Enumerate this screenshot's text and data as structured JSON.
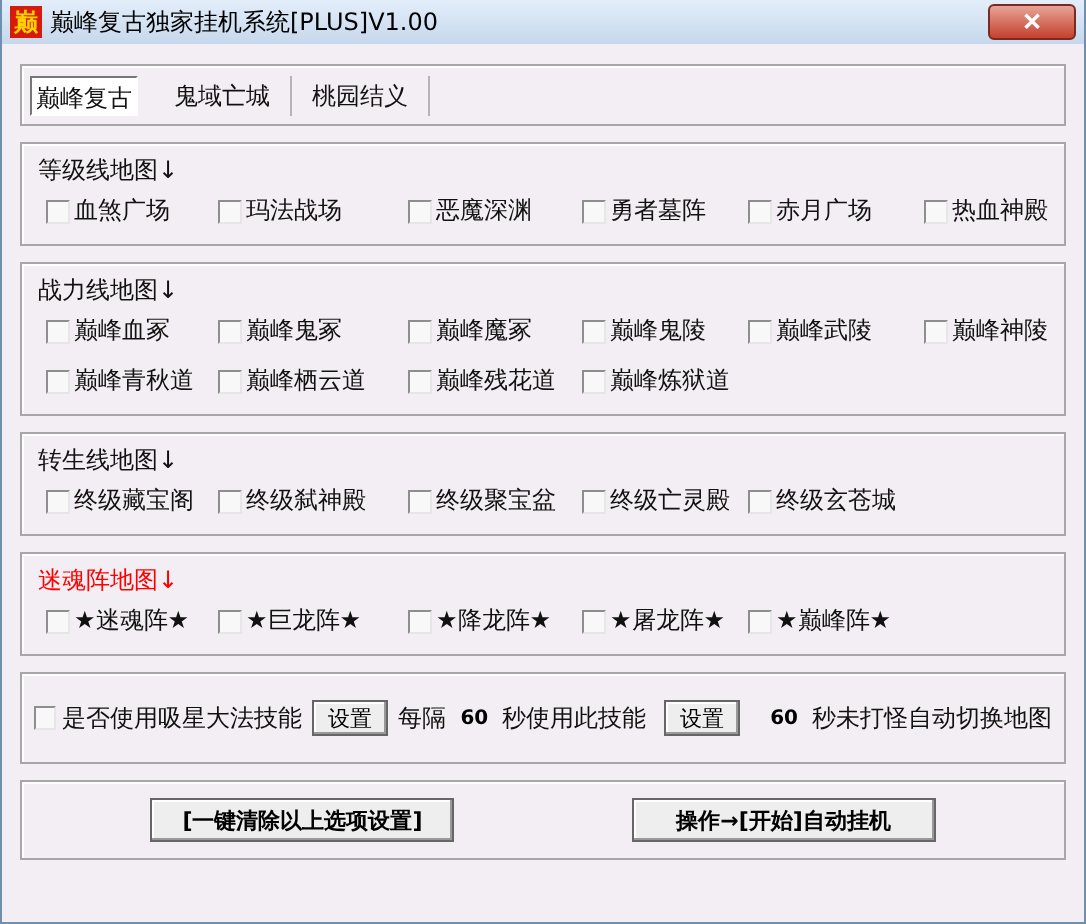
{
  "window": {
    "title": "巅峰复古独家挂机系统[PLUS]V1.00",
    "icon_text": "巅",
    "close": "✕"
  },
  "tabs": [
    {
      "label": "巅峰复古",
      "selected": true
    },
    {
      "label": "鬼域亡城",
      "selected": false
    },
    {
      "label": "桃园结义",
      "selected": false
    }
  ],
  "groups": [
    {
      "title": "等级线地图↓",
      "kind": "normal",
      "items": [
        {
          "label": "血煞广场",
          "checked": false
        },
        {
          "label": "玛法战场",
          "checked": false
        },
        {
          "label": "恶魔深渊",
          "checked": false
        },
        {
          "label": "勇者墓阵",
          "checked": false
        },
        {
          "label": "赤月广场",
          "checked": false
        },
        {
          "label": "热血神殿",
          "checked": false
        }
      ]
    },
    {
      "title": "战力线地图↓",
      "kind": "normal",
      "items": [
        {
          "label": "巅峰血冢",
          "checked": false
        },
        {
          "label": "巅峰鬼冢",
          "checked": false
        },
        {
          "label": "巅峰魔冢",
          "checked": false
        },
        {
          "label": "巅峰鬼陵",
          "checked": false
        },
        {
          "label": "巅峰武陵",
          "checked": false
        },
        {
          "label": "巅峰神陵",
          "checked": false
        },
        {
          "label": "巅峰青秋道",
          "checked": false
        },
        {
          "label": "巅峰栖云道",
          "checked": false
        },
        {
          "label": "巅峰残花道",
          "checked": false
        },
        {
          "label": "巅峰炼狱道",
          "checked": false
        }
      ]
    },
    {
      "title": "转生线地图↓",
      "kind": "normal",
      "items": [
        {
          "label": "终级藏宝阁",
          "checked": false
        },
        {
          "label": "终级弑神殿",
          "checked": false
        },
        {
          "label": "终级聚宝盆",
          "checked": false
        },
        {
          "label": "终级亡灵殿",
          "checked": false
        },
        {
          "label": "终级玄苍城",
          "checked": false
        }
      ]
    },
    {
      "title": "迷魂阵地图↓",
      "kind": "special",
      "items": [
        {
          "label": "★迷魂阵★",
          "checked": false
        },
        {
          "label": "★巨龙阵★",
          "checked": false
        },
        {
          "label": "★降龙阵★",
          "checked": false
        },
        {
          "label": "★屠龙阵★",
          "checked": false
        },
        {
          "label": "★巅峰阵★",
          "checked": false
        }
      ]
    }
  ],
  "skill": {
    "label": "是否使用吸星大法技能",
    "checked": false,
    "button_1": "设置",
    "text_1": "每隔",
    "interval": "60",
    "text_2": "秒使用此技能",
    "button_2": "设置",
    "timeout": "60",
    "text_3": "秒未打怪自动切换地图"
  },
  "buttons": [
    "[一键清除以上选项设置]",
    "操作→[开始]自动挂机"
  ]
}
